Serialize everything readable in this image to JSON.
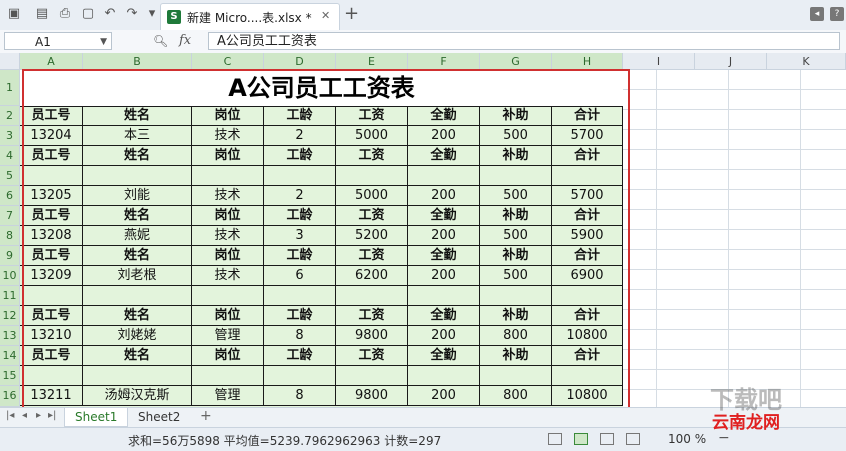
{
  "tab": {
    "title": "新建 Micro....表.xlsx *",
    "close": "✕",
    "new": "+"
  },
  "formula": {
    "cell_ref": "A1",
    "fx": "fx",
    "content": "A公司员工工资表"
  },
  "columns": [
    "A",
    "B",
    "C",
    "D",
    "E",
    "F",
    "G",
    "H",
    "I",
    "J",
    "K"
  ],
  "rows": [
    "1",
    "2",
    "3",
    "4",
    "5",
    "6",
    "7",
    "8",
    "9",
    "10",
    "11",
    "12",
    "13",
    "14",
    "15",
    "16"
  ],
  "sheet": {
    "title": "A公司员工工资表",
    "header": [
      "员工号",
      "姓名",
      "岗位",
      "工龄",
      "工资",
      "全勤",
      "补助",
      "合计"
    ],
    "data": [
      {
        "r": 2,
        "v": [
          "员工号",
          "姓名",
          "岗位",
          "工龄",
          "工资",
          "全勤",
          "补助",
          "合计"
        ],
        "hdr": true
      },
      {
        "r": 3,
        "v": [
          "13204",
          "本三",
          "技术",
          "2",
          "5000",
          "200",
          "500",
          "5700"
        ]
      },
      {
        "r": 4,
        "v": [
          "员工号",
          "姓名",
          "岗位",
          "工龄",
          "工资",
          "全勤",
          "补助",
          "合计"
        ],
        "hdr": true
      },
      {
        "r": 5,
        "v": [
          "",
          "",
          "",
          "",
          "",
          "",
          "",
          ""
        ]
      },
      {
        "r": 6,
        "v": [
          "13205",
          "刘能",
          "技术",
          "2",
          "5000",
          "200",
          "500",
          "5700"
        ]
      },
      {
        "r": 7,
        "v": [
          "员工号",
          "姓名",
          "岗位",
          "工龄",
          "工资",
          "全勤",
          "补助",
          "合计"
        ],
        "hdr": true
      },
      {
        "r": 8,
        "v": [
          "13208",
          "燕妮",
          "技术",
          "3",
          "5200",
          "200",
          "500",
          "5900"
        ]
      },
      {
        "r": 9,
        "v": [
          "员工号",
          "姓名",
          "岗位",
          "工龄",
          "工资",
          "全勤",
          "补助",
          "合计"
        ],
        "hdr": true
      },
      {
        "r": 10,
        "v": [
          "13209",
          "刘老根",
          "技术",
          "6",
          "6200",
          "200",
          "500",
          "6900"
        ]
      },
      {
        "r": 11,
        "v": [
          "",
          "",
          "",
          "",
          "",
          "",
          "",
          ""
        ]
      },
      {
        "r": 12,
        "v": [
          "员工号",
          "姓名",
          "岗位",
          "工龄",
          "工资",
          "全勤",
          "补助",
          "合计"
        ],
        "hdr": true
      },
      {
        "r": 13,
        "v": [
          "13210",
          "刘姥姥",
          "管理",
          "8",
          "9800",
          "200",
          "800",
          "10800"
        ]
      },
      {
        "r": 14,
        "v": [
          "员工号",
          "姓名",
          "岗位",
          "工龄",
          "工资",
          "全勤",
          "补助",
          "合计"
        ],
        "hdr": true
      },
      {
        "r": 15,
        "v": [
          "",
          "",
          "",
          "",
          "",
          "",
          "",
          ""
        ]
      },
      {
        "r": 16,
        "v": [
          "13211",
          "汤姆汉克斯",
          "管理",
          "8",
          "9800",
          "200",
          "800",
          "10800"
        ]
      }
    ]
  },
  "sheets": [
    "Sheet1",
    "Sheet2"
  ],
  "status": {
    "summary": "求和=56万5898   平均值=5239.7962962963   计数=297",
    "zoom": "100 %",
    "minus": "−"
  },
  "watermark": "下载吧",
  "logo": "云南龙网",
  "colors": {
    "accent_green": "#2a7a2a",
    "selection_red": "#d03030",
    "cell_fill": "#e3f4dc"
  }
}
